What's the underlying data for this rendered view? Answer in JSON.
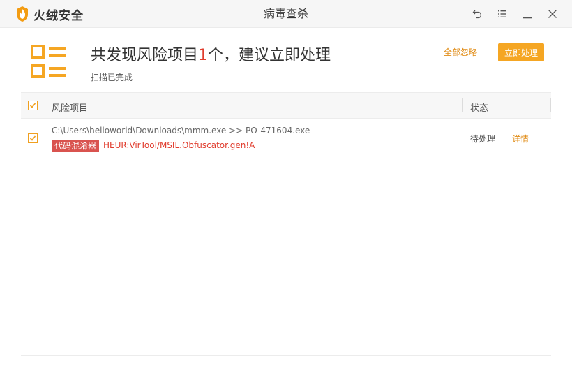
{
  "app": {
    "brand": "火绒安全",
    "window_title": "病毒查杀"
  },
  "colors": {
    "accent": "#f5a623",
    "danger": "#e03c2d",
    "tag_bg": "#d9534f"
  },
  "window_controls": [
    {
      "name": "back-icon"
    },
    {
      "name": "menu-icon"
    },
    {
      "name": "minimize-icon"
    },
    {
      "name": "close-icon"
    }
  ],
  "summary": {
    "headline_prefix": "共发现风险项目",
    "count": "1",
    "headline_suffix": "个，建议立即处理",
    "status": "扫描已完成",
    "ignore_all": "全部忽略",
    "handle_now": "立即处理"
  },
  "table": {
    "columns": [
      "风险项目",
      "状态"
    ],
    "rows": [
      {
        "checked": true,
        "path": "C:\\Users\\helloworld\\Downloads\\mmm.exe >> PO-471604.exe",
        "tag": "代码混淆器",
        "threat": "HEUR:VirTool/MSIL.Obfuscator.gen!A",
        "status": "待处理",
        "action": "详情"
      }
    ]
  }
}
